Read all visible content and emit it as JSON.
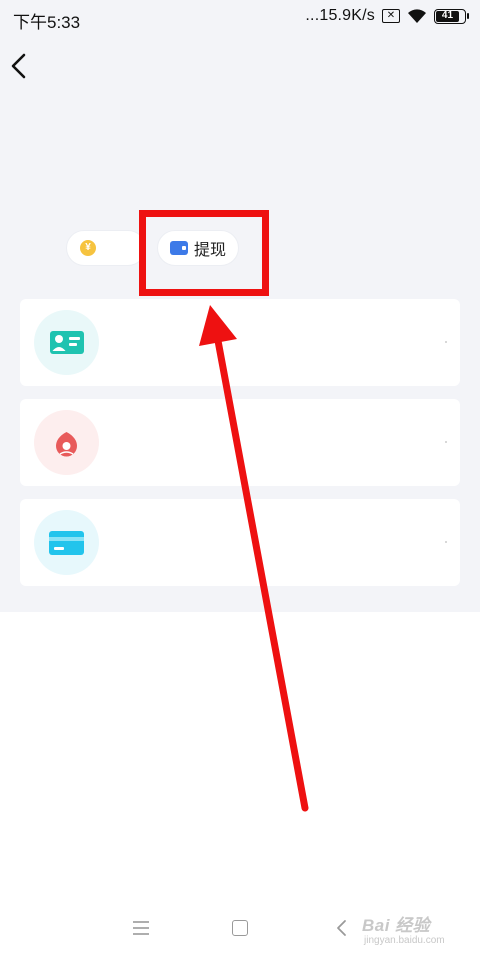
{
  "status_bar": {
    "time": "下午5:33",
    "network_speed": "...15.9K/s",
    "sim_icon": "sim-absent-icon",
    "wifi_icon": "wifi-icon",
    "battery_level": "41"
  },
  "header": {
    "back_icon": "chevron-left-icon"
  },
  "pills": {
    "coin_icon": "yuan-coin-icon",
    "coin_icon_glyph": "¥",
    "withdraw_icon": "wallet-icon",
    "withdraw_label": "提现"
  },
  "cards": [
    {
      "icon": "id-card-icon",
      "icon_color": "#1fc3b0"
    },
    {
      "icon": "red-seal-icon",
      "icon_color": "#e85b5b"
    },
    {
      "icon": "bank-card-icon",
      "icon_color": "#22c4ec"
    }
  ],
  "annotation": {
    "color": "#ee1111"
  },
  "nav_bar": {
    "menu_icon": "menu-icon",
    "home_icon": "home-square-icon",
    "back_icon": "back-triangle-icon"
  },
  "watermark": {
    "logo_text": "Bai 经验",
    "url": "jingyan.baidu.com"
  }
}
